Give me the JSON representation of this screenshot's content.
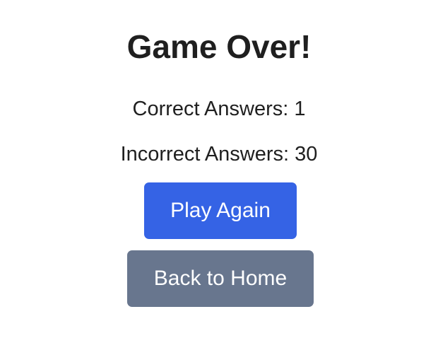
{
  "game_over": {
    "title": "Game Over!",
    "correct_label": "Correct Answers:",
    "correct_value": "1",
    "incorrect_label": "Incorrect Answers:",
    "incorrect_value": "30",
    "play_again_label": "Play Again",
    "back_home_label": "Back to Home"
  },
  "colors": {
    "primary_button": "#3563e5",
    "secondary_button": "#68768e",
    "text": "#1f1f1f",
    "background": "#ffffff"
  }
}
